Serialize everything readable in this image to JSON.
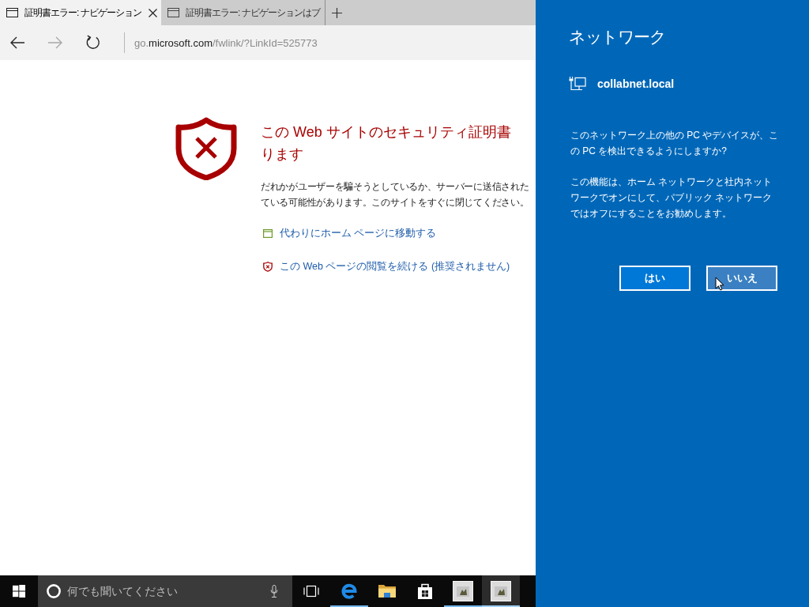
{
  "browser": {
    "tabs": [
      {
        "title": "証明書エラー: ナビゲーション",
        "selected": true
      },
      {
        "title": "証明書エラー: ナビゲーションはブ",
        "selected": false
      }
    ],
    "nav_buttons": [
      {
        "kind": "back",
        "disabled": false
      },
      {
        "kind": "forward",
        "disabled": true
      },
      {
        "kind": "refresh",
        "disabled": false
      }
    ],
    "address": {
      "prefix": "go.",
      "domain": "microsoft.com",
      "path": "/fwlink/?LinkId=525773"
    },
    "error_page": {
      "title_lines": [
        "この Web サイトのセキュリティ証明書",
        "ります"
      ],
      "message_lines": [
        "だれかがユーザーを騙そうとしているか、サーバーに送信された",
        "ている可能性があります。このサイトをすぐに閉じてください。"
      ],
      "links": [
        {
          "kind": "home",
          "label": "代わりにホーム ページに移動する"
        },
        {
          "kind": "continue",
          "label": "この Web ページの閲覧を続ける (推奨されません)"
        }
      ]
    }
  },
  "taskbar": {
    "search": {
      "placeholder": "何でも聞いてください"
    },
    "apps": [
      {
        "kind": "browser",
        "running": true,
        "active": false
      },
      {
        "kind": "files",
        "running": false,
        "active": false
      },
      {
        "kind": "store",
        "running": false,
        "active": false
      },
      {
        "kind": "app",
        "running": true,
        "active": false
      },
      {
        "kind": "app",
        "running": true,
        "active": true
      }
    ]
  },
  "network_panel": {
    "title": "ネットワーク",
    "network_name": "collabnet.local",
    "paragraphs": [
      "このネットワーク上の他の PC やデバイスが、この PC を検出できるようにしますか?",
      "この機能は、ホーム ネットワークと社内ネットワークでオンにして、パブリック ネットワークではオフにすることをお勧めします。"
    ],
    "buttons": [
      {
        "label": "はい",
        "hovered": false
      },
      {
        "label": "いいえ",
        "hovered": true
      }
    ]
  }
}
